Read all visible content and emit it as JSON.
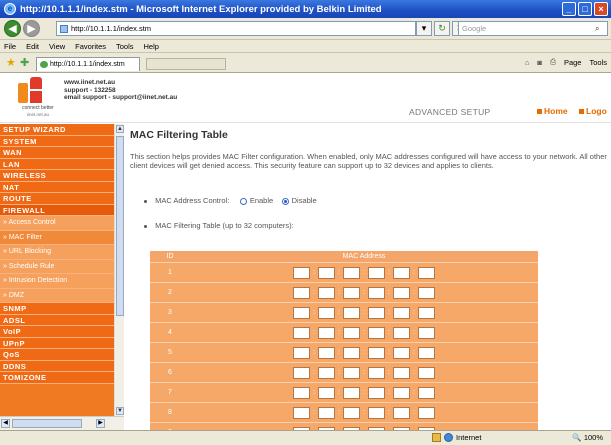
{
  "window": {
    "title": "http://10.1.1.1/index.stm - Microsoft Internet Explorer provided by Belkin Limited",
    "minimize": "_",
    "maximize": "□",
    "close": "×"
  },
  "nav": {
    "back": "◀",
    "forward": "▶",
    "address": "http://10.1.1.1/index.stm",
    "search_placeholder": "Google",
    "refresh": "↻",
    "stop": "✕",
    "dropdown": "▾",
    "search_go": "⌕"
  },
  "menu": [
    "File",
    "Edit",
    "View",
    "Favorites",
    "Tools",
    "Help"
  ],
  "tabs": {
    "current": "http://10.1.1.1/index.stm"
  },
  "toolbar": {
    "page": "Page",
    "tools": "Tools"
  },
  "header": {
    "logo_tagline": "connect better",
    "logo_domain": "iinet.net.au",
    "contact_line1": "www.iinet.net.au",
    "contact_line2": "support - 132258",
    "contact_line3": "email support - support@iinet.net.au",
    "advanced_setup": "ADVANCED SETUP",
    "home_link": "Home",
    "logout_link": "Logo"
  },
  "sidebar": {
    "items": [
      {
        "label": "SETUP WIZARD",
        "type": "head"
      },
      {
        "label": "SYSTEM",
        "type": "head"
      },
      {
        "label": "WAN",
        "type": "head"
      },
      {
        "label": "LAN",
        "type": "head"
      },
      {
        "label": "WIRELESS",
        "type": "head"
      },
      {
        "label": "NAT",
        "type": "head"
      },
      {
        "label": "ROUTE",
        "type": "head"
      },
      {
        "label": "FIREWALL",
        "type": "head"
      },
      {
        "label": "» Access Control",
        "type": "sub"
      },
      {
        "label": "» MAC Filter",
        "type": "sub"
      },
      {
        "label": "» URL Blocking",
        "type": "sub"
      },
      {
        "label": "» Schedule Rule",
        "type": "sub"
      },
      {
        "label": "» Intrusion Detection",
        "type": "sub"
      },
      {
        "label": "» DMZ",
        "type": "sub"
      },
      {
        "label": "SNMP",
        "type": "head"
      },
      {
        "label": "ADSL",
        "type": "head"
      },
      {
        "label": "VoIP",
        "type": "head"
      },
      {
        "label": "UPnP",
        "type": "head"
      },
      {
        "label": "QoS",
        "type": "head"
      },
      {
        "label": "DDNS",
        "type": "head"
      },
      {
        "label": "TOMIZONE",
        "type": "head"
      }
    ]
  },
  "main": {
    "title": "MAC Filtering Table",
    "description": "This section helps provides MAC Filter configuration. When enabled, only MAC addresses configured will have access to your network. All other client devices will get denied access. This security feature can support up to 32 devices and applies to clients.",
    "mac_control_label": "MAC Address Control:",
    "enable_label": "Enable",
    "disable_label": "Disable",
    "selected": "Disable",
    "table_label": "MAC Filtering Table (up to 32 computers):",
    "table": {
      "col_id": "ID",
      "col_mac": "MAC Address",
      "rows": [
        "1",
        "2",
        "3",
        "4",
        "5",
        "6",
        "7",
        "8",
        "9"
      ]
    }
  },
  "status": {
    "zone": "Internet",
    "zoom": "100%"
  }
}
